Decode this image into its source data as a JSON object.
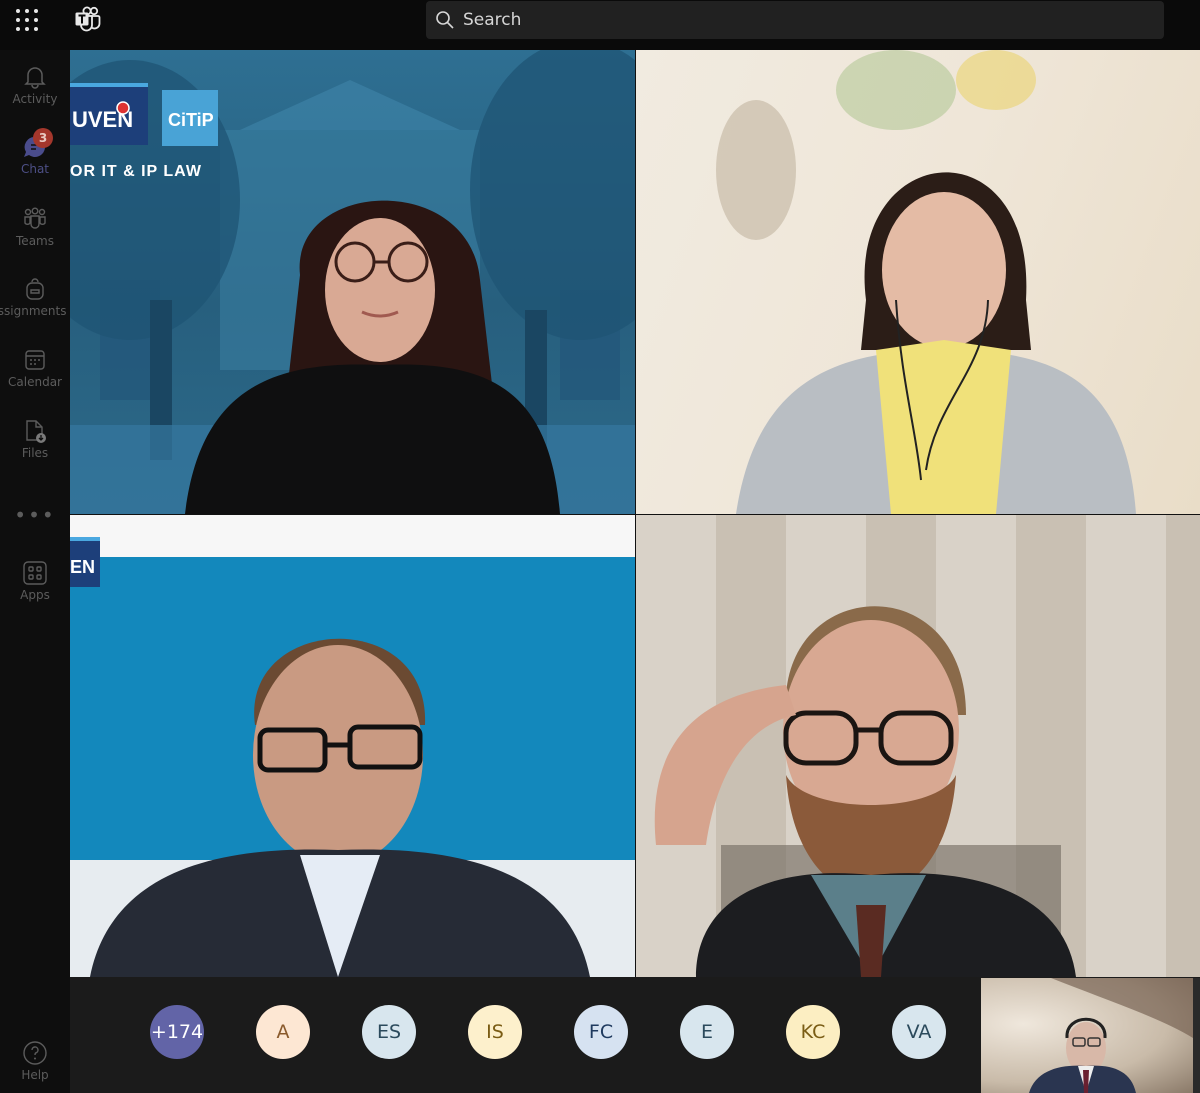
{
  "app": {
    "name": "Microsoft Teams",
    "search": {
      "placeholder": "Search"
    }
  },
  "rail": {
    "items": [
      {
        "id": "activity",
        "label": "Activity",
        "icon": "bell-icon",
        "active": false
      },
      {
        "id": "chat",
        "label": "Chat",
        "icon": "chat-icon",
        "active": true,
        "badge": "3"
      },
      {
        "id": "teams",
        "label": "Teams",
        "icon": "teams-icon",
        "active": false
      },
      {
        "id": "assignments",
        "label": "Assignments",
        "icon": "backpack-icon",
        "active": false
      },
      {
        "id": "calendar",
        "label": "Calendar",
        "icon": "calendar-icon",
        "active": false
      },
      {
        "id": "files",
        "label": "Files",
        "icon": "file-download-icon",
        "active": false
      },
      {
        "id": "more",
        "label": "...",
        "icon": "more-icon",
        "active": false
      },
      {
        "id": "apps",
        "label": "Apps",
        "icon": "apps-icon",
        "active": false
      },
      {
        "id": "help",
        "label": "Help",
        "icon": "help-icon",
        "active": false
      }
    ]
  },
  "meeting": {
    "tiles": [
      {
        "id": "tile-1",
        "description": "woman with glasses, dark hair, black top",
        "background": {
          "logo_text": "UVEN",
          "logo2_text": "CiTiP",
          "caption": "OR IT & IP LAW"
        }
      },
      {
        "id": "tile-2",
        "description": "woman with earphones, yellow turtleneck, grey blazer"
      },
      {
        "id": "tile-3",
        "description": "man with glasses, dark suit",
        "background": {
          "logo_text": "EN"
        }
      },
      {
        "id": "tile-4",
        "description": "bearded man with glasses adjusting frames"
      }
    ],
    "overflow": [
      {
        "initials": "+174",
        "bg": "#6264a7",
        "fg": "#ffffff"
      },
      {
        "initials": "A",
        "bg": "#fde7d3",
        "fg": "#8a5a2b"
      },
      {
        "initials": "ES",
        "bg": "#d8e6ee",
        "fg": "#2b4a5c"
      },
      {
        "initials": "IS",
        "bg": "#fdf0cc",
        "fg": "#7a5c14"
      },
      {
        "initials": "FC",
        "bg": "#d6e2f1",
        "fg": "#1f3a5f"
      },
      {
        "initials": "E",
        "bg": "#d8e6ee",
        "fg": "#2b4a5c"
      },
      {
        "initials": "KC",
        "bg": "#fceec2",
        "fg": "#7a5c14"
      },
      {
        "initials": "VA",
        "bg": "#d8e6ee",
        "fg": "#2b4a5c"
      }
    ],
    "self_view": {
      "description": "man with headset, suit and tie"
    }
  }
}
